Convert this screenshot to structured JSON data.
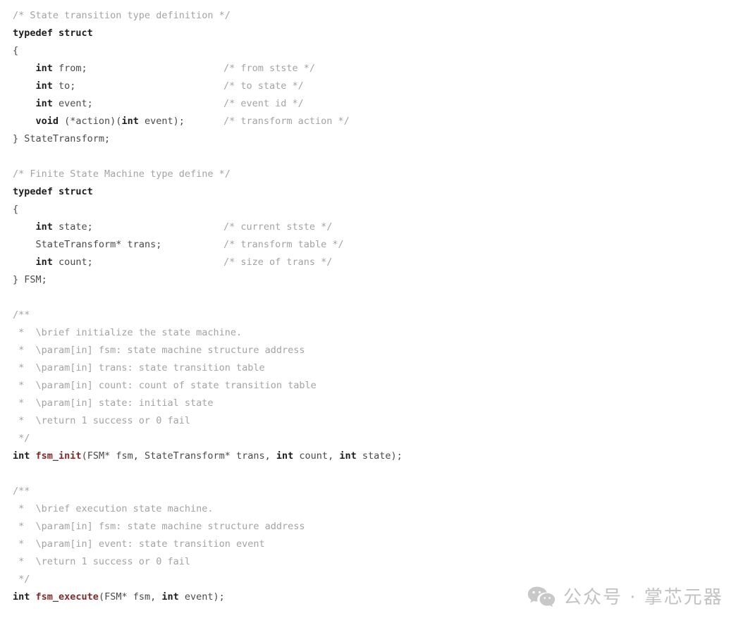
{
  "document": {
    "language": "c",
    "background_color": "#ffffff",
    "colors": {
      "comment": "#a3a3a3",
      "keyword": "#1d1d1d",
      "identifier": "#4a4a4a",
      "function": "#7d2b2b"
    },
    "lines": [
      {
        "indent": 0,
        "tokens": [
          {
            "t": "cm",
            "v": "/* State transition type definition */"
          }
        ]
      },
      {
        "indent": 0,
        "tokens": [
          {
            "t": "kw",
            "v": "typedef struct"
          }
        ]
      },
      {
        "indent": 0,
        "tokens": [
          {
            "t": "id",
            "v": "{"
          }
        ]
      },
      {
        "indent": 1,
        "tokens": [
          {
            "t": "kw",
            "v": "int"
          },
          {
            "t": "id",
            "v": " from;"
          }
        ],
        "comment": "/* from stste */"
      },
      {
        "indent": 1,
        "tokens": [
          {
            "t": "kw",
            "v": "int"
          },
          {
            "t": "id",
            "v": " to;"
          }
        ],
        "comment": "/* to state */"
      },
      {
        "indent": 1,
        "tokens": [
          {
            "t": "kw",
            "v": "int"
          },
          {
            "t": "id",
            "v": " event;"
          }
        ],
        "comment": "/* event id */"
      },
      {
        "indent": 1,
        "tokens": [
          {
            "t": "kw",
            "v": "void"
          },
          {
            "t": "id",
            "v": " (*action)("
          },
          {
            "t": "kw",
            "v": "int"
          },
          {
            "t": "id",
            "v": " event);"
          }
        ],
        "comment": "/* transform action */"
      },
      {
        "indent": 0,
        "tokens": [
          {
            "t": "id",
            "v": "} StateTransform;"
          }
        ]
      },
      {
        "indent": 0,
        "tokens": []
      },
      {
        "indent": 0,
        "tokens": [
          {
            "t": "cm",
            "v": "/* Finite State Machine type define */"
          }
        ]
      },
      {
        "indent": 0,
        "tokens": [
          {
            "t": "kw",
            "v": "typedef struct"
          }
        ]
      },
      {
        "indent": 0,
        "tokens": [
          {
            "t": "id",
            "v": "{"
          }
        ]
      },
      {
        "indent": 1,
        "tokens": [
          {
            "t": "kw",
            "v": "int"
          },
          {
            "t": "id",
            "v": " state;"
          }
        ],
        "comment": "/* current stste */"
      },
      {
        "indent": 1,
        "tokens": [
          {
            "t": "id",
            "v": "StateTransform* trans;"
          }
        ],
        "comment": "/* transform table */"
      },
      {
        "indent": 1,
        "tokens": [
          {
            "t": "kw",
            "v": "int"
          },
          {
            "t": "id",
            "v": " count;"
          }
        ],
        "comment": "/* size of trans */"
      },
      {
        "indent": 0,
        "tokens": [
          {
            "t": "id",
            "v": "} FSM;"
          }
        ]
      },
      {
        "indent": 0,
        "tokens": []
      },
      {
        "indent": 0,
        "tokens": [
          {
            "t": "cm",
            "v": "/**"
          }
        ]
      },
      {
        "indent": 0,
        "tokens": [
          {
            "t": "cm",
            "v": " *  \\brief initialize the state machine."
          }
        ]
      },
      {
        "indent": 0,
        "tokens": [
          {
            "t": "cm",
            "v": " *  \\param[in] fsm: state machine structure address"
          }
        ]
      },
      {
        "indent": 0,
        "tokens": [
          {
            "t": "cm",
            "v": " *  \\param[in] trans: state transition table"
          }
        ]
      },
      {
        "indent": 0,
        "tokens": [
          {
            "t": "cm",
            "v": " *  \\param[in] count: count of state transition table"
          }
        ]
      },
      {
        "indent": 0,
        "tokens": [
          {
            "t": "cm",
            "v": " *  \\param[in] state: initial state"
          }
        ]
      },
      {
        "indent": 0,
        "tokens": [
          {
            "t": "cm",
            "v": " *  \\return 1 success or 0 fail"
          }
        ]
      },
      {
        "indent": 0,
        "tokens": [
          {
            "t": "cm",
            "v": " */"
          }
        ]
      },
      {
        "indent": 0,
        "tokens": [
          {
            "t": "kw",
            "v": "int"
          },
          {
            "t": "id",
            "v": " "
          },
          {
            "t": "fn",
            "v": "fsm_init"
          },
          {
            "t": "id",
            "v": "(FSM* fsm, StateTransform* trans, "
          },
          {
            "t": "kw",
            "v": "int"
          },
          {
            "t": "id",
            "v": " count, "
          },
          {
            "t": "kw",
            "v": "int"
          },
          {
            "t": "id",
            "v": " state);"
          }
        ]
      },
      {
        "indent": 0,
        "tokens": []
      },
      {
        "indent": 0,
        "tokens": [
          {
            "t": "cm",
            "v": "/**"
          }
        ]
      },
      {
        "indent": 0,
        "tokens": [
          {
            "t": "cm",
            "v": " *  \\brief execution state machine."
          }
        ]
      },
      {
        "indent": 0,
        "tokens": [
          {
            "t": "cm",
            "v": " *  \\param[in] fsm: state machine structure address"
          }
        ]
      },
      {
        "indent": 0,
        "tokens": [
          {
            "t": "cm",
            "v": " *  \\param[in] event: state transition event"
          }
        ]
      },
      {
        "indent": 0,
        "tokens": [
          {
            "t": "cm",
            "v": " *  \\return 1 success or 0 fail"
          }
        ]
      },
      {
        "indent": 0,
        "tokens": [
          {
            "t": "cm",
            "v": " */"
          }
        ]
      },
      {
        "indent": 0,
        "tokens": [
          {
            "t": "kw",
            "v": "int"
          },
          {
            "t": "id",
            "v": " "
          },
          {
            "t": "fn",
            "v": "fsm_execute"
          },
          {
            "t": "id",
            "v": "(FSM* fsm, "
          },
          {
            "t": "kw",
            "v": "int"
          },
          {
            "t": "id",
            "v": " event);"
          }
        ]
      }
    ]
  },
  "watermark": {
    "icon": "wechat-icon",
    "text": "公众号 · 掌芯元器",
    "color": "#c2c2c2"
  }
}
